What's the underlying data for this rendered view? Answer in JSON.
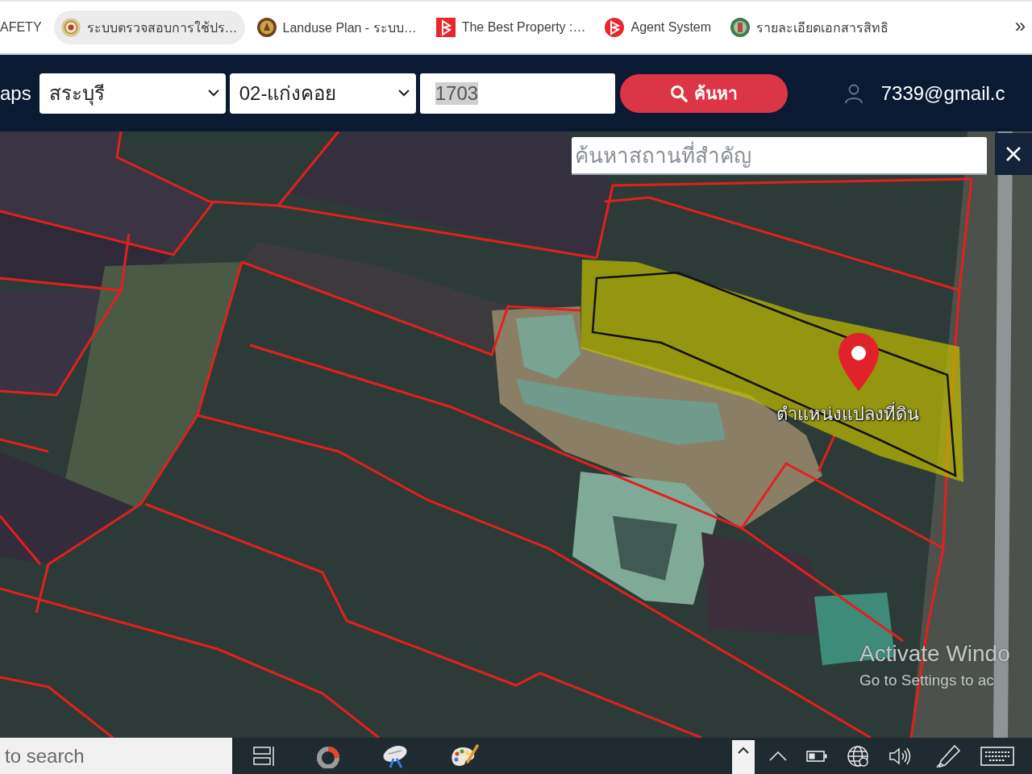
{
  "bookmarks": {
    "items": [
      {
        "label": "AFETY",
        "kind": "plain",
        "hovered": false
      },
      {
        "label": "ระบบตรวจสอบการใช้ปร…",
        "kind": "seal",
        "hovered": true
      },
      {
        "label": "Landuse Plan - ระบบ…",
        "kind": "emblem",
        "hovered": false
      },
      {
        "label": "The Best Property :…",
        "kind": "brand-square",
        "hovered": false
      },
      {
        "label": "Agent System",
        "kind": "brand-round",
        "hovered": false
      },
      {
        "label": "รายละเอียดเอกสารสิทธิ",
        "kind": "emblem-green",
        "hovered": false
      }
    ],
    "overflow": "»"
  },
  "nav": {
    "title": "aps",
    "province": {
      "value": "สระบุรี"
    },
    "district": {
      "value": "02-แก่งคอย"
    },
    "parcel_number": {
      "value": "1703",
      "text_selected": true
    },
    "search_button": {
      "label": "ค้นหา"
    },
    "user": {
      "email": "7339@gmail.c"
    }
  },
  "map": {
    "place_search": {
      "placeholder": "ค้นหาสถานที่สำคัญ"
    },
    "marker_label": "ตำแหน่งแปลงที่ดิน"
  },
  "activation_notice": {
    "title": "Activate Windo",
    "subtitle": "Go to Settings to ac"
  },
  "taskbar": {
    "search": {
      "placeholder": "to search"
    }
  }
}
